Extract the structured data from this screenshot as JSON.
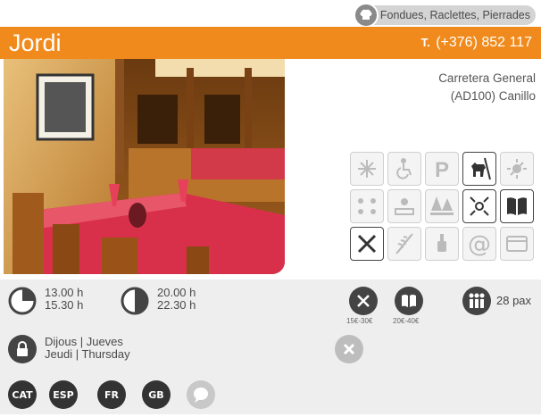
{
  "category": "Fondues, Raclettes, Pierrades",
  "restaurant": {
    "name": "Jordi",
    "phone_prefix": "T.",
    "phone": "(+376) 852 117",
    "address_line1": "Carretera General",
    "address_line2": "(AD100) Canillo"
  },
  "services": [
    {
      "name": "air-conditioning",
      "active": false
    },
    {
      "name": "wheelchair-access",
      "active": false
    },
    {
      "name": "parking",
      "active": false
    },
    {
      "name": "pets-allowed",
      "active": true
    },
    {
      "name": "sun-terrace",
      "active": false
    },
    {
      "name": "outdoor-terrace",
      "active": false
    },
    {
      "name": "sunny-view",
      "active": false
    },
    {
      "name": "forest-view",
      "active": false
    },
    {
      "name": "center-location",
      "active": true
    },
    {
      "name": "menu",
      "active": true
    },
    {
      "name": "restaurant-cutlery",
      "active": true
    },
    {
      "name": "gluten-free",
      "active": false
    },
    {
      "name": "wine-cellar",
      "active": false
    },
    {
      "name": "internet",
      "active": false
    },
    {
      "name": "credit-cards",
      "active": false
    }
  ],
  "schedule": {
    "lunch_open": "13.00 h",
    "lunch_close": "15.30 h",
    "dinner_open": "20.00 h",
    "dinner_close": "22.30 h"
  },
  "prices": {
    "menu_range": "15€-30€",
    "carta_range": "20€-40€"
  },
  "capacity": "28 pax",
  "closed_days": {
    "line1": "Dijous | Jueves",
    "line2": "Jeudi | Thursday"
  },
  "languages": [
    "CAT",
    "ESP",
    "FR",
    "GB"
  ],
  "colors": {
    "accent": "#f08a1c",
    "panel": "#eeeeee",
    "icon_dark": "#444444"
  }
}
